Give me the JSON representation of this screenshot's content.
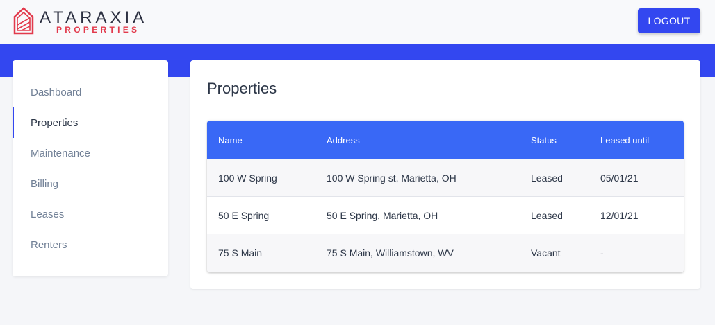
{
  "brand": {
    "name": "ATARAXIA",
    "tagline": "PROPERTIES",
    "accent": "#e23a4c",
    "primary": "#3347f0"
  },
  "header": {
    "logout_label": "LOGOUT"
  },
  "sidebar": {
    "items": [
      {
        "label": "Dashboard",
        "active": false
      },
      {
        "label": "Properties",
        "active": true
      },
      {
        "label": "Maintenance",
        "active": false
      },
      {
        "label": "Billing",
        "active": false
      },
      {
        "label": "Leases",
        "active": false
      },
      {
        "label": "Renters",
        "active": false
      }
    ]
  },
  "main": {
    "title": "Properties",
    "table": {
      "columns": [
        "Name",
        "Address",
        "Status",
        "Leased until"
      ],
      "rows": [
        [
          "100 W Spring",
          "100 W Spring st, Marietta, OH",
          "Leased",
          "05/01/21"
        ],
        [
          "50 E Spring",
          "50 E Spring, Marietta, OH",
          "Leased",
          "12/01/21"
        ],
        [
          "75 S Main",
          "75 S Main, Williamstown, WV",
          "Vacant",
          "-"
        ]
      ]
    }
  },
  "icons": {
    "logo": "house-logo-icon"
  }
}
